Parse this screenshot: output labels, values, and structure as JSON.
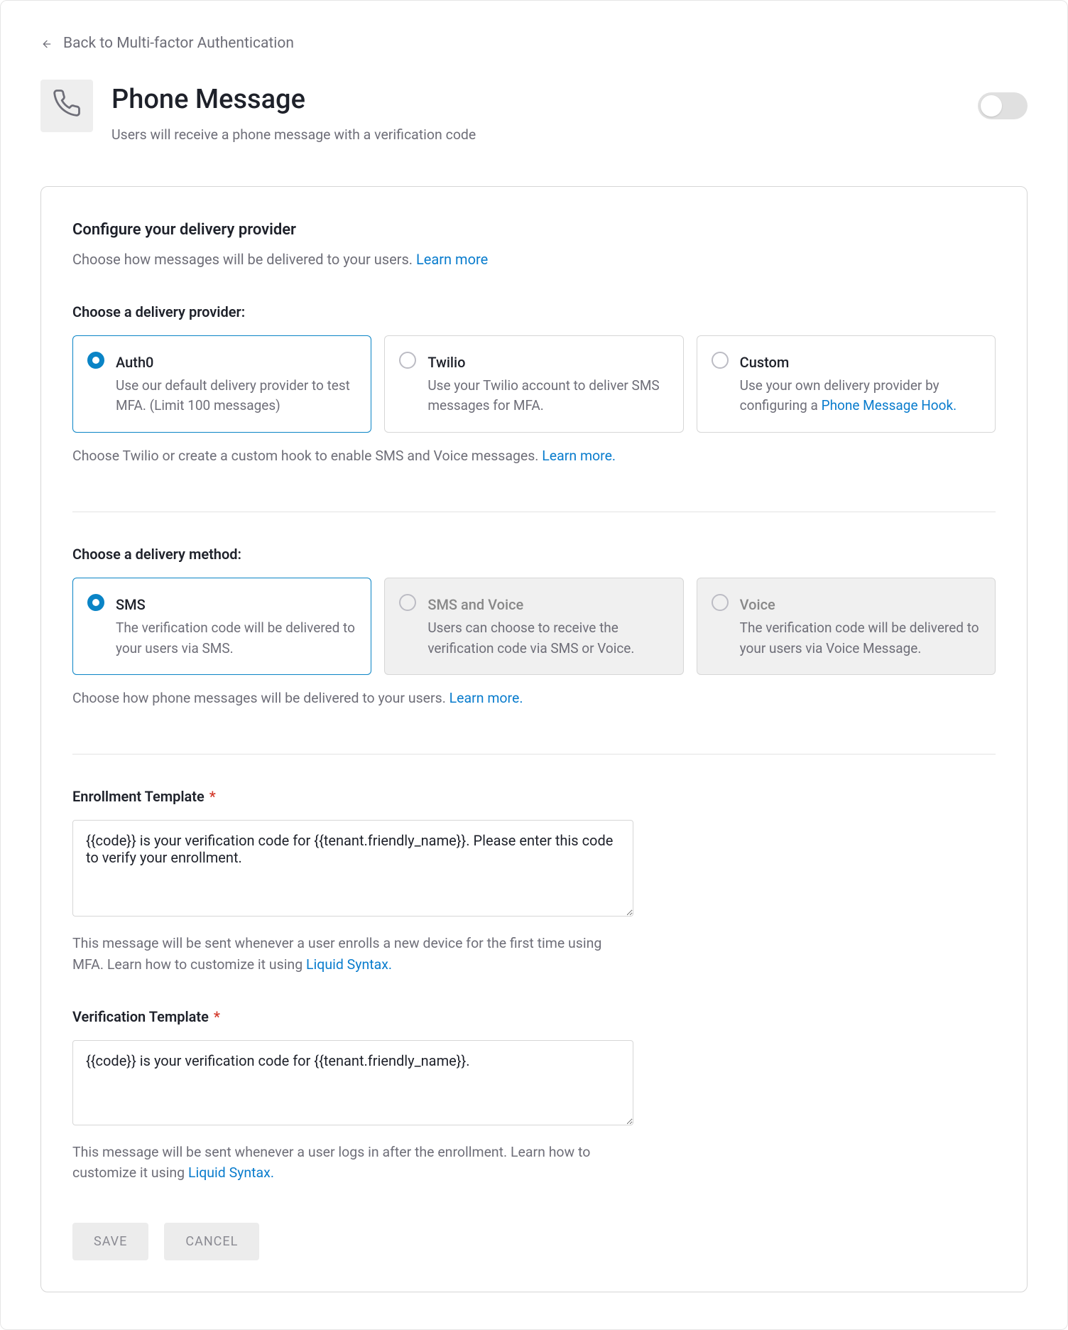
{
  "back_label": "Back to Multi-factor Authentication",
  "page_title": "Phone Message",
  "page_subtitle": "Users will receive a phone message with a verification code",
  "toggle_on": false,
  "card": {
    "title": "Configure your delivery provider",
    "subtitle": "Choose how messages will be delivered to your users. ",
    "subtitle_link": "Learn more",
    "provider_label": "Choose a delivery provider:",
    "provider_hint_prefix": "Choose Twilio or create a custom hook to enable SMS and Voice messages. ",
    "provider_hint_link": "Learn more.",
    "providers": [
      {
        "name": "Auth0",
        "desc": "Use our default delivery provider to test MFA. (Limit 100 messages)",
        "selected": true,
        "disabled": false
      },
      {
        "name": "Twilio",
        "desc": "Use your Twilio account to deliver SMS messages for MFA.",
        "selected": false,
        "disabled": false
      },
      {
        "name": "Custom",
        "desc_prefix": "Use your own delivery provider by configuring a ",
        "desc_link": "Phone Message Hook.",
        "selected": false,
        "disabled": false
      }
    ],
    "method_label": "Choose a delivery method:",
    "method_hint_prefix": "Choose how phone messages will be delivered to your users. ",
    "method_hint_link": "Learn more.",
    "methods": [
      {
        "name": "SMS",
        "desc": "The verification code will be delivered to your users via SMS.",
        "selected": true,
        "disabled": false
      },
      {
        "name": "SMS and Voice",
        "desc": "Users can choose to receive the verification code via SMS or Voice.",
        "selected": false,
        "disabled": true
      },
      {
        "name": "Voice",
        "desc": "The verification code will be delivered to your users via Voice Message.",
        "selected": false,
        "disabled": true
      }
    ],
    "enroll_label": "Enrollment Template",
    "enroll_value": "{{code}} is your verification code for {{tenant.friendly_name}}. Please enter this code to verify your enrollment.",
    "enroll_help_prefix": "This message will be sent whenever a user enrolls a new device for the first time using MFA. Learn how to customize it using ",
    "enroll_help_link": "Liquid Syntax.",
    "verify_label": "Verification Template",
    "verify_value": "{{code}} is your verification code for {{tenant.friendly_name}}.",
    "verify_help_prefix": "This message will be sent whenever a user logs in after the enrollment. Learn how to customize it using ",
    "verify_help_link": "Liquid Syntax.",
    "save_label": "SAVE",
    "cancel_label": "CANCEL"
  }
}
